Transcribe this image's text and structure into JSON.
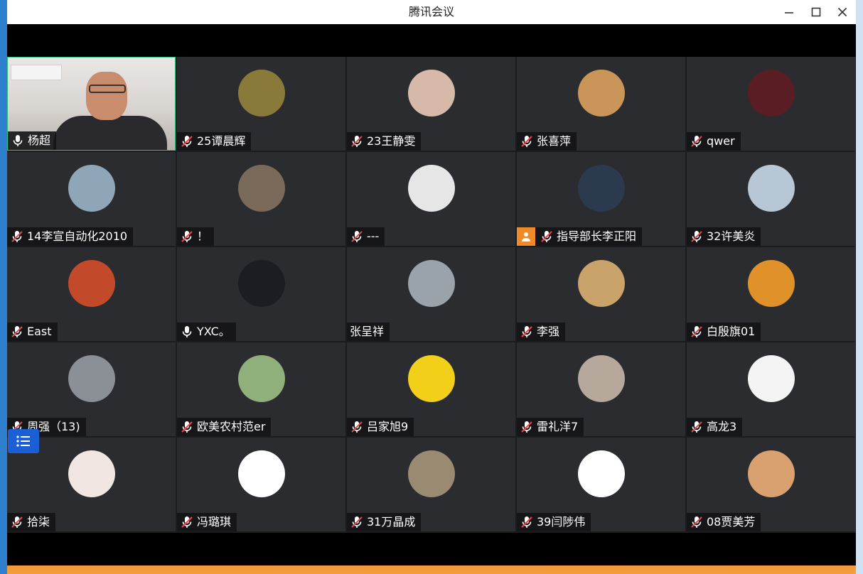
{
  "window": {
    "title": "腾讯会议",
    "minimize_icon": "minimize-icon",
    "maximize_icon": "maximize-icon",
    "close_icon": "close-icon"
  },
  "colors": {
    "tile_bg": "#2b2c2f",
    "label_bg": "#141416",
    "speaking_border": "#2ec27e",
    "host_badge": "#f08a28",
    "list_button": "#1a5fd6"
  },
  "participants": [
    {
      "name": "杨超",
      "mic": "on",
      "video": true
    },
    {
      "name": "25谭晨辉",
      "mic": "muted",
      "avatar_color": "#8a7a3a"
    },
    {
      "name": "23王静雯",
      "mic": "muted",
      "avatar_color": "#d6b9a8"
    },
    {
      "name": "张喜萍",
      "mic": "muted",
      "avatar_color": "#c99558"
    },
    {
      "name": "qwer",
      "mic": "muted",
      "avatar_color": "#5a1d24"
    },
    {
      "name": "14李宣自动化2010",
      "mic": "muted",
      "avatar_color": "#8fa6b8"
    },
    {
      "name": "！",
      "mic": "muted",
      "avatar_color": "#7a6a5a"
    },
    {
      "name": "---",
      "mic": "muted",
      "avatar_color": "#e6e6e6"
    },
    {
      "name": "指导部长李正阳",
      "mic": "muted",
      "avatar_color": "#2b3a4e",
      "host": true
    },
    {
      "name": "32许美炎",
      "mic": "muted",
      "avatar_color": "#b8c7d6"
    },
    {
      "name": "East",
      "mic": "muted",
      "avatar_color": "#c24a2a"
    },
    {
      "name": "YXC。",
      "mic": "on",
      "avatar_color": "#1c1d22"
    },
    {
      "name": "张呈祥",
      "mic": "none",
      "avatar_color": "#9aa3a9"
    },
    {
      "name": "李强",
      "mic": "muted",
      "avatar_color": "#c9a36a"
    },
    {
      "name": "白殷旗01",
      "mic": "muted",
      "avatar_color": "#e0912a"
    },
    {
      "name": "周强（13)",
      "mic": "muted",
      "avatar_color": "#8b8f96"
    },
    {
      "name": "欧美农村范er",
      "mic": "muted",
      "avatar_color": "#8fb07a"
    },
    {
      "name": "吕家旭9",
      "mic": "muted",
      "avatar_color": "#f2d01a"
    },
    {
      "name": "雷礼洋7",
      "mic": "muted",
      "avatar_color": "#b6a89a"
    },
    {
      "name": "高龙3",
      "mic": "muted",
      "avatar_color": "#f4f4f4"
    },
    {
      "name": "拾柒",
      "mic": "muted",
      "avatar_color": "#f1e6e1"
    },
    {
      "name": "冯璐琪",
      "mic": "muted",
      "avatar_color": "#ffffff"
    },
    {
      "name": "31万晶成",
      "mic": "muted",
      "avatar_color": "#9b8a72"
    },
    {
      "name": "39闫陟伟",
      "mic": "muted",
      "avatar_color": "#ffffff"
    },
    {
      "name": "08贾美芳",
      "mic": "muted",
      "avatar_color": "#d9a070"
    }
  ],
  "list_button_icon": "list-icon"
}
